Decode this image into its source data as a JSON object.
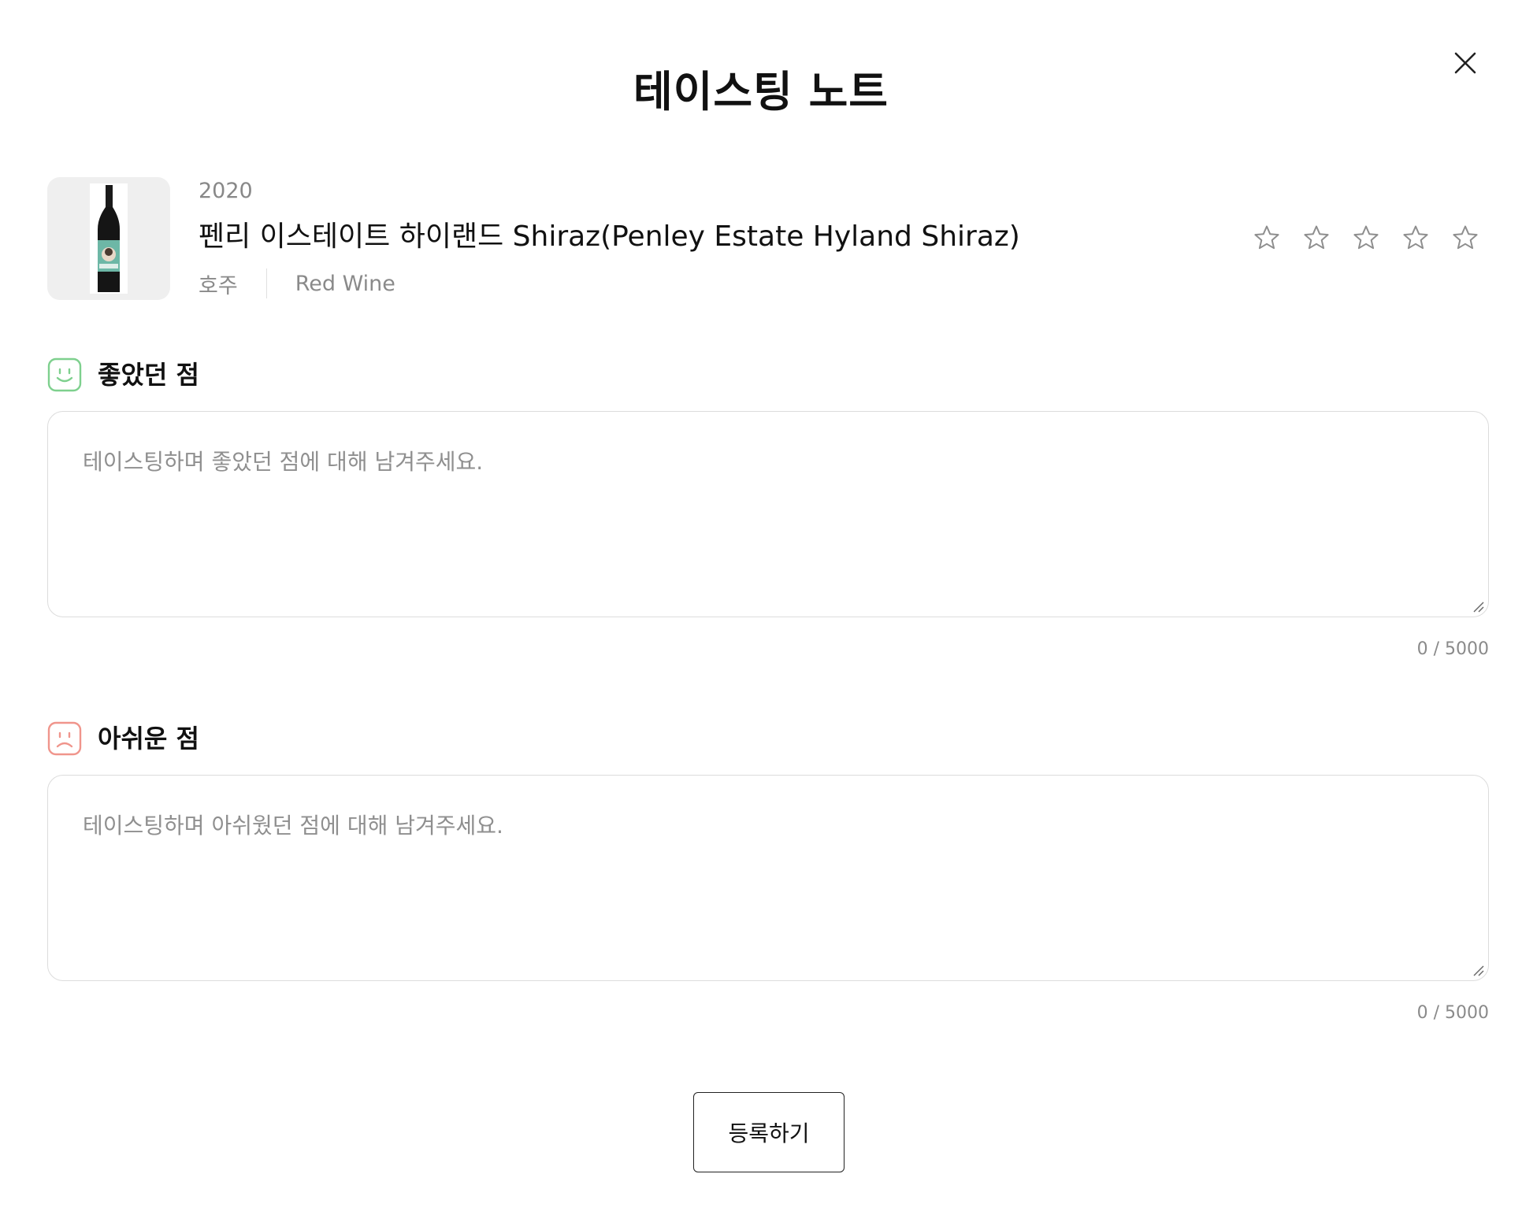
{
  "modal": {
    "title": "테이스팅 노트",
    "close_icon": "close-icon"
  },
  "wine": {
    "year": "2020",
    "name": "펜리 이스테이트 하이랜드 Shiraz(Penley Estate Hyland Shiraz)",
    "country": "호주",
    "type": "Red Wine",
    "image_icon": "wine-bottle-image"
  },
  "rating": {
    "value": 0,
    "max": 5,
    "icon": "star-outline-icon"
  },
  "sections": {
    "good": {
      "title": "좋았던 점",
      "icon": "smile-face-icon",
      "icon_color": "#7ed08e",
      "placeholder": "테이스팅하며 좋았던 점에 대해 남겨주세요.",
      "value": "",
      "count": "0 / 5000"
    },
    "bad": {
      "title": "아쉬운 점",
      "icon": "sad-face-icon",
      "icon_color": "#f0958c",
      "placeholder": "테이스팅하며 아쉬웠던 점에 대해 남겨주세요.",
      "value": "",
      "count": "0 / 5000"
    }
  },
  "submit": {
    "label": "등록하기"
  }
}
